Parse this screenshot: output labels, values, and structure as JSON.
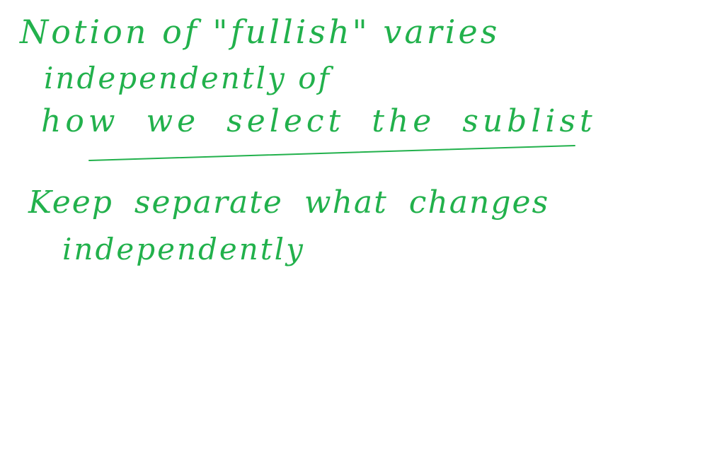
{
  "ink_color": "#22b14c",
  "background_color": "#ffffff",
  "notes": {
    "line1": "Notion of \"fullish\" varies",
    "line2": "independently of",
    "line3": "how we select the sublist",
    "line4": "Keep separate what changes",
    "line5": "independently"
  }
}
